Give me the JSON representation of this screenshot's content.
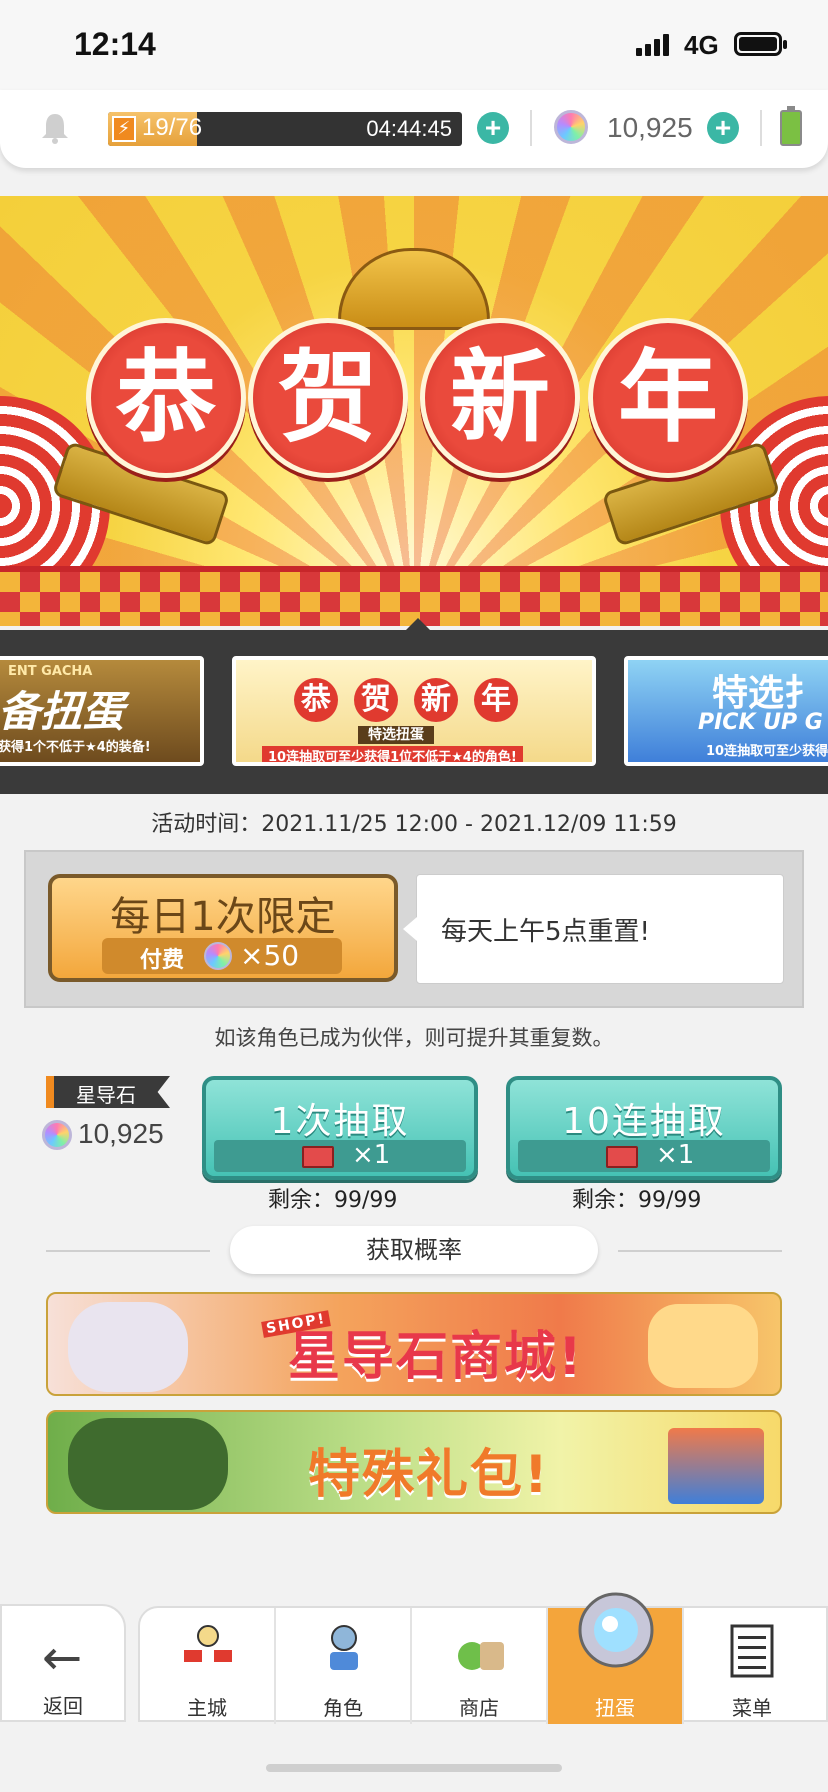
{
  "status_bar": {
    "time": "12:14",
    "network": "4G"
  },
  "resources": {
    "stamina": "19/76",
    "stamina_fraction": 0.25,
    "stamina_timer": "04:44:45",
    "gems": "10,925"
  },
  "banner": {
    "chars": [
      "恭",
      "贺",
      "新",
      "年"
    ]
  },
  "carousel": {
    "left_card": {
      "line1": "ENT GACHA",
      "title": "备扭蛋",
      "sub": "获得1个不低于★4的装备!"
    },
    "center_card": {
      "chars": [
        "恭",
        "贺",
        "新",
        "年"
      ],
      "tag": "特选扭蛋",
      "sub": "10连抽取可至少获得1位不低于★4的角色!"
    },
    "right_card": {
      "title": "特选扌",
      "pickup": "PICK UP G",
      "sub": "10连抽取可至少获得1位"
    }
  },
  "event_time": "活动时间：2021.11/25 12:00 - 2021.12/09 11:59",
  "daily": {
    "title": "每日1次限定",
    "cost_label": "付费",
    "cost_mult": "×50",
    "reset_text": "每天上午5点重置!"
  },
  "note": "如该角色已成为伙伴，则可提升其重复数。",
  "currency": {
    "label": "星导石",
    "count": "10,925"
  },
  "pulls": [
    {
      "title": "1次抽取",
      "ticket_mult": "×1",
      "remaining": "剩余：99/99"
    },
    {
      "title": "10连抽取",
      "ticket_mult": "×1",
      "remaining": "剩余：99/99"
    }
  ],
  "rate_button": "获取概率",
  "promos": [
    {
      "text": "星导石商城!",
      "badge": "SHOP!"
    },
    {
      "text": "特殊礼包!"
    }
  ],
  "nav": {
    "back": "返回",
    "tabs": [
      "主城",
      "角色",
      "商店",
      "扭蛋",
      "菜单"
    ],
    "active_index": 3
  },
  "colors": {
    "accent_teal": "#45c2b4",
    "accent_orange": "#f4a53b",
    "banner_red": "#e03a2f"
  }
}
